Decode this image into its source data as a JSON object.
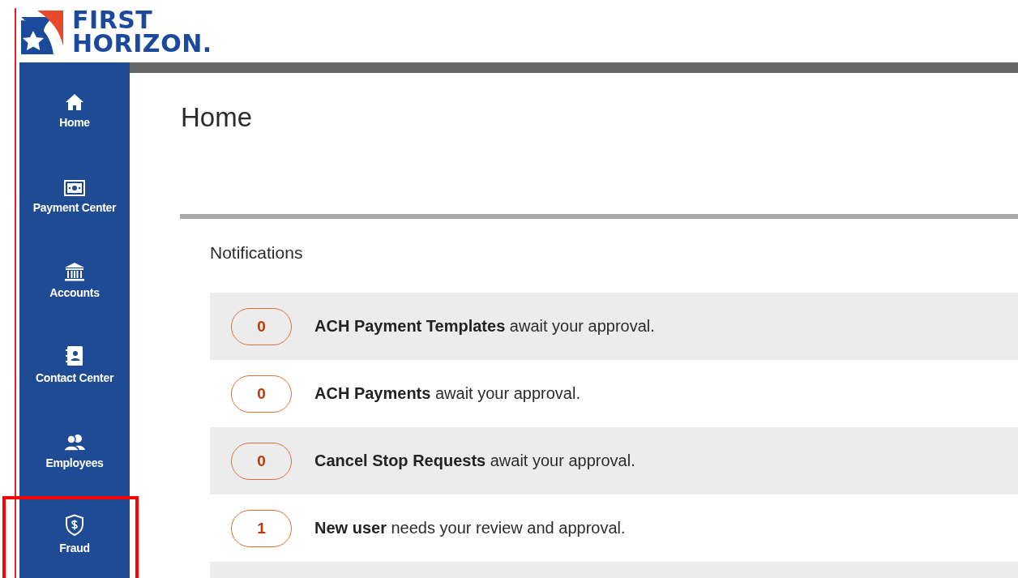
{
  "logo": {
    "line_1": "FIRST",
    "line_2": "HORIZON."
  },
  "sidebar": {
    "items": [
      {
        "label": "Home",
        "highlighted": false
      },
      {
        "label": "Payment Center",
        "highlighted": false
      },
      {
        "label": "Accounts",
        "highlighted": false
      },
      {
        "label": "Contact Center",
        "highlighted": false
      },
      {
        "label": "Employees",
        "highlighted": false
      },
      {
        "label": "Fraud",
        "highlighted": true
      }
    ]
  },
  "page": {
    "title": "Home"
  },
  "notifications": {
    "heading": "Notifications",
    "items": [
      {
        "count": "0",
        "text": "**ACH Payment Templates** await your approval."
      },
      {
        "count": "0",
        "text": "**ACH Payments** await your approval."
      },
      {
        "count": "0",
        "text": "**Cancel Stop Requests** await your approval."
      },
      {
        "count": "1",
        "text": "**New user** needs your review and approval."
      }
    ]
  }
}
